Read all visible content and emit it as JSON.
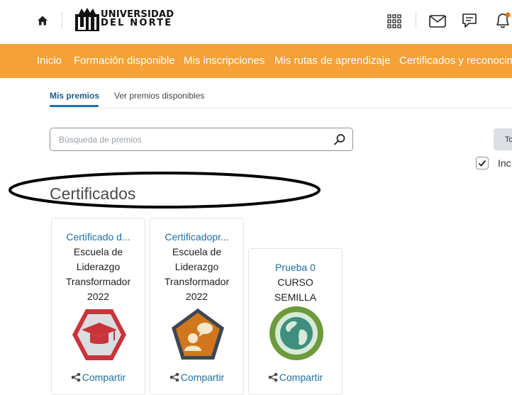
{
  "header": {
    "logo": {
      "line1": "UNIVERSIDAD",
      "line2": "DEL NORTE",
      "mark": "UN"
    },
    "icons": [
      "home-icon",
      "app-grid-icon",
      "mail-icon",
      "chat-icon",
      "bell-icon"
    ]
  },
  "nav": {
    "items": [
      "Inicio",
      "Formación disponible",
      "Mis inscripciones",
      "Mis rutas de aprendizaje",
      "Certificados y reconocim"
    ],
    "color": "#f4a137"
  },
  "tabs": [
    {
      "label": "Mis premios",
      "active": true
    },
    {
      "label": "Ver premios disponibles",
      "active": false
    }
  ],
  "search": {
    "placeholder": "Búsqueda de premios",
    "value": ""
  },
  "right_panel": {
    "button_label": "To",
    "checkbox_label": "Inc",
    "checked": true
  },
  "section": {
    "title": "Certificados"
  },
  "cards": [
    {
      "title": "Certificado d...",
      "desc_lines": [
        "Escuela de",
        "Liderazgo",
        "Transformador",
        "2022"
      ],
      "badge": "graduation-cap-hexagon-badge",
      "badge_color": "#c8343a",
      "share_label": "Compartir"
    },
    {
      "title": "Certificadopr...",
      "desc_lines": [
        "Escuela de",
        "Liderazgo",
        "Transformador",
        "2022"
      ],
      "badge": "person-speech-pentagon-badge",
      "badge_color": "#c66a1c",
      "share_label": "Compartir"
    },
    {
      "title": "Prueba 0",
      "desc_lines": [
        "CURSO",
        "SEMILLA"
      ],
      "badge": "globe-circle-badge",
      "badge_color": "#6d9a3a",
      "share_label": "Compartir"
    }
  ]
}
